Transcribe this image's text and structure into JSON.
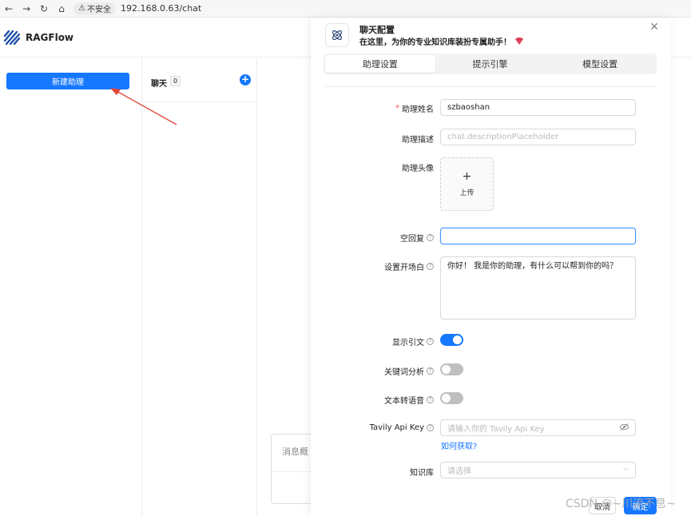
{
  "browser": {
    "back_icon": "←",
    "forward_icon": "→",
    "reload_icon": "↻",
    "home_icon": "⌂",
    "insecure_label": "不安全",
    "url": "192.168.0.63/chat"
  },
  "app": {
    "title": "RAGFlow",
    "new_assistant_label": "新建助理",
    "chat_label": "聊天",
    "chat_count": "0",
    "add_icon": "+",
    "message_card_title": "消息概"
  },
  "modal": {
    "title": "聊天配置",
    "subtitle": "在这里，为你的专业知识库装扮专属助手！",
    "close_icon": "✕",
    "tabs": [
      {
        "label": "助理设置",
        "active": true
      },
      {
        "label": "提示引擎",
        "active": false
      },
      {
        "label": "模型设置",
        "active": false
      }
    ],
    "form": {
      "name_label": "助理姓名",
      "name_value": "szbaoshan",
      "desc_label": "助理描述",
      "desc_placeholder": "chat.descriptionPlaceholder",
      "avatar_label": "助理头像",
      "upload_icon": "+",
      "upload_label": "上传",
      "empty_reply_label": "空回复",
      "opener_label": "设置开场白",
      "opener_value": "你好！ 我是你的助理，有什么可以帮到你的吗？",
      "show_quote_label": "显示引文",
      "show_quote_on": true,
      "keyword_label": "关键词分析",
      "keyword_on": false,
      "tts_label": "文本转语音",
      "tts_on": false,
      "tavily_label": "Tavily Api Key",
      "tavily_placeholder": "请输入你的 Tavily Api Key",
      "tavily_help_link": "如何获取?",
      "kb_label": "知识库",
      "kb_placeholder": "请选择"
    },
    "cancel_label": "取消",
    "ok_label": "确定"
  },
  "watermark": "CSDN @~川流不息~",
  "colors": {
    "accent": "#1677ff",
    "required": "#ff4d4f",
    "arrow": "#e0463a"
  }
}
